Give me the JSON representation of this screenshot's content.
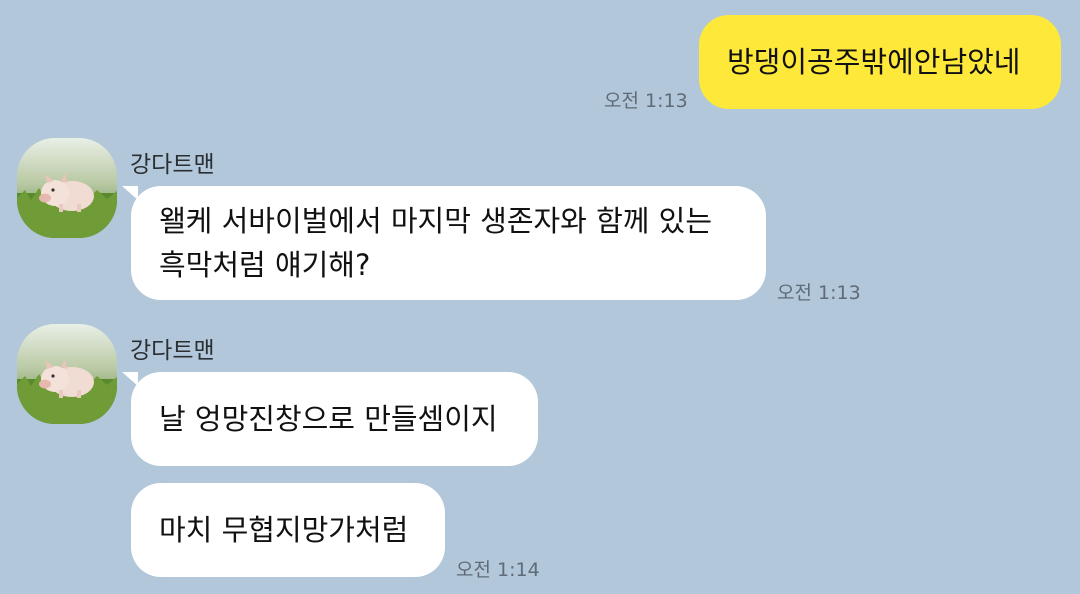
{
  "messages": [
    {
      "sender": "me",
      "text": "방댕이공주밖에안남았네",
      "time": "오전 1:13"
    },
    {
      "sender": "강다트맨",
      "lines": [
        "왤케 서바이벌에서 마지막 생존자와 함께 있는",
        "흑막처럼 얘기해?"
      ],
      "time": "오전 1:13"
    },
    {
      "sender": "강다트맨",
      "text": "날 엉망진창으로 만들셈이지"
    },
    {
      "text": "마치 무협지망가처럼",
      "time": "오전 1:14"
    }
  ],
  "colors": {
    "background": "#b2c7da",
    "my_bubble": "#fee93a",
    "their_bubble": "#ffffff"
  },
  "avatar_icon": "piglet-on-grass-photo"
}
